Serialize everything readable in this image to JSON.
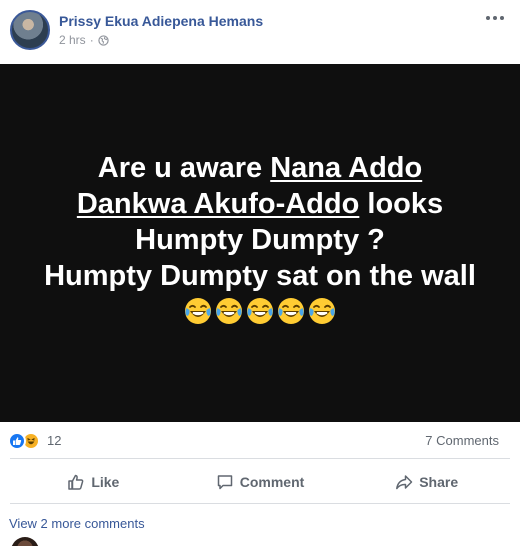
{
  "post": {
    "author_name": "Prissy Ekua Adiepena Hemans",
    "timestamp": "2 hrs",
    "separator": "·",
    "privacy_icon": "globe-icon",
    "image_text": {
      "line1_prefix": "Are u aware ",
      "mention_part1": "Nana Addo",
      "mention_part2": "Dankwa Akufo-Addo",
      "line2_suffix": " looks",
      "line3": "Humpty Dumpty ?",
      "line4": "Humpty Dumpty sat on the wall",
      "emoji_name": "laughing-crying-emoji",
      "emoji_count": 5
    }
  },
  "reactions": {
    "types": [
      "like",
      "haha"
    ],
    "count": "12",
    "comments_label": "7 Comments"
  },
  "actions": {
    "like_label": "Like",
    "comment_label": "Comment",
    "share_label": "Share"
  },
  "comments": {
    "view_more_label": "View 2 more comments"
  },
  "colors": {
    "author": "#385898",
    "image_background": "#0f0f0f",
    "like_blue": "#1877f2",
    "haha_yellow": "#f7b125",
    "muted_text": "#606770"
  }
}
